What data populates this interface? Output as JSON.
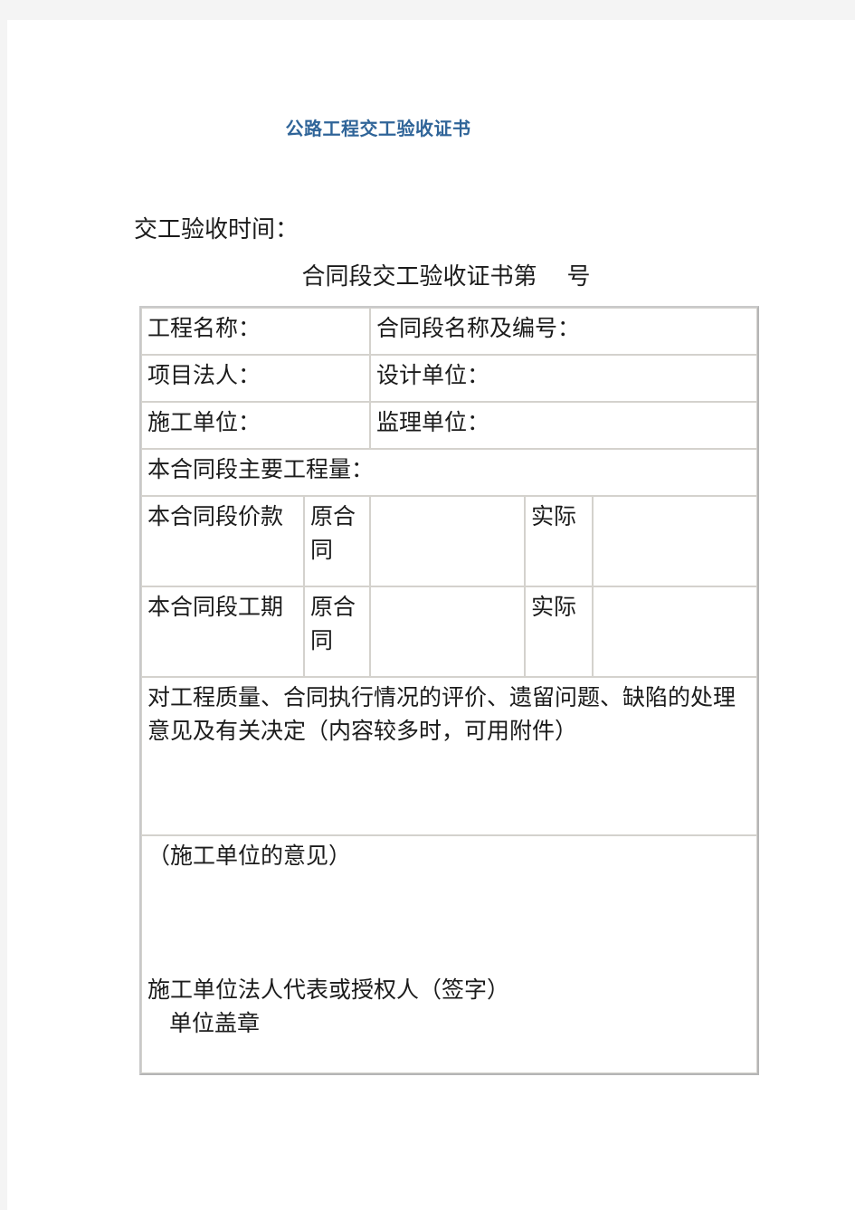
{
  "document": {
    "title": "公路工程交工验收证书",
    "title_color": "#2f6498",
    "handover_time_label": "交工验收时间：",
    "certificate_line": "合同段交工验收证书第    号"
  },
  "table": {
    "rows": {
      "project_name_label": "工程名称：",
      "contract_section_label": "合同段名称及编号：",
      "project_legal_person_label": "项目法人：",
      "design_unit_label": "设计单位：",
      "construction_unit_label": "施工单位：",
      "supervision_unit_label": "监理单位：",
      "main_quantity_label": "本合同段主要工程量：",
      "contract_price_label": "本合同段价款",
      "contract_price_original": "原合同",
      "contract_price_original_value": "",
      "contract_price_actual": "实际",
      "contract_price_actual_value": "",
      "contract_period_label": "本合同段工期",
      "contract_period_original": "原合同",
      "contract_period_original_value": "",
      "contract_period_actual": "实际",
      "contract_period_actual_value": "",
      "evaluation_label": "对工程质量、合同执行情况的评价、遗留问题、缺陷的处理意见及有关决定（内容较多时，可用附件）",
      "opinion_label": "（施工单位的意见）",
      "signature_label": "施工单位法人代表或授权人（签字）",
      "seal_label": "单位盖章"
    }
  }
}
